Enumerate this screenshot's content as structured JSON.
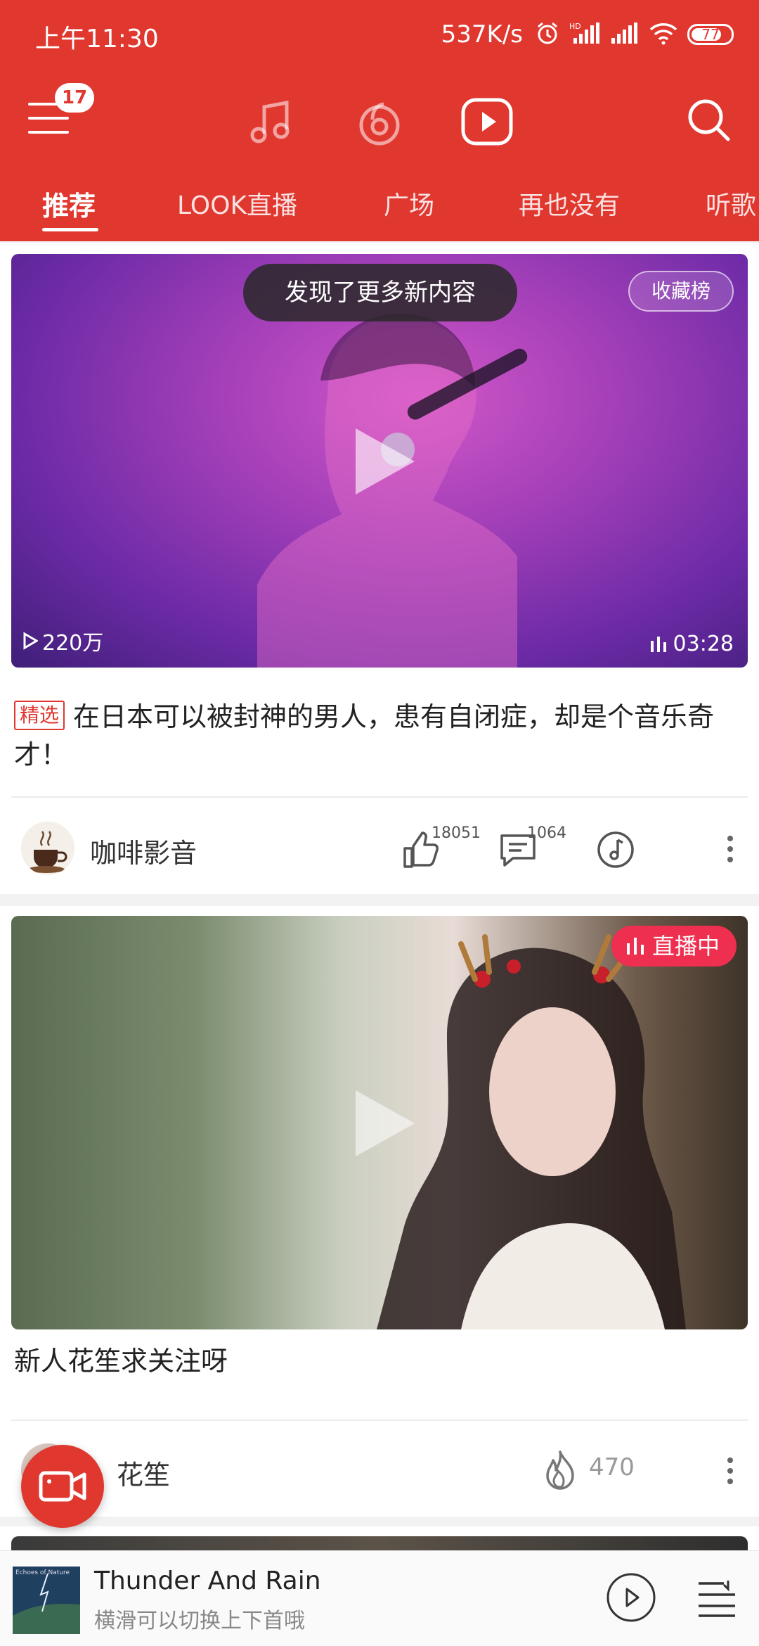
{
  "status_bar": {
    "time": "上午11:30",
    "speed": "537K/s",
    "battery": "77",
    "battery_level": 0.77,
    "icons": [
      "alarm-icon",
      "hd-signal-icon",
      "signal-icon",
      "wifi-icon",
      "battery-icon"
    ]
  },
  "topbar": {
    "menu_badge": "17",
    "nav_icons": [
      "music-note-icon",
      "netease-radio-icon",
      "video-play-icon"
    ],
    "active_nav": "video-play-icon"
  },
  "tabs": [
    {
      "label": "推荐",
      "active": true
    },
    {
      "label": "LOOK直播",
      "active": false
    },
    {
      "label": "广场",
      "active": false
    },
    {
      "label": "再也没有",
      "active": false
    },
    {
      "label": "听歌",
      "active": false
    }
  ],
  "feed": [
    {
      "notice": "发现了更多新内容",
      "chart_badge": "收藏榜",
      "views": "220万",
      "duration": "03:28",
      "tag": "精选",
      "title": "在日本可以被封神的男人，患有自闭症，却是个音乐奇才！",
      "author": "咖啡影音",
      "likes": "18051",
      "comments": "1064"
    },
    {
      "live_badge": "直播中",
      "title": "新人花笙求关注呀",
      "author": "花笙",
      "hot": "470"
    }
  ],
  "player": {
    "cover_text": "Echoes of Nature",
    "title": "Thunder And Rain",
    "subtitle": "横滑可以切换上下首哦"
  },
  "colors": {
    "brand_red": "#e0372f",
    "live_pink": "#ee2f4f"
  }
}
